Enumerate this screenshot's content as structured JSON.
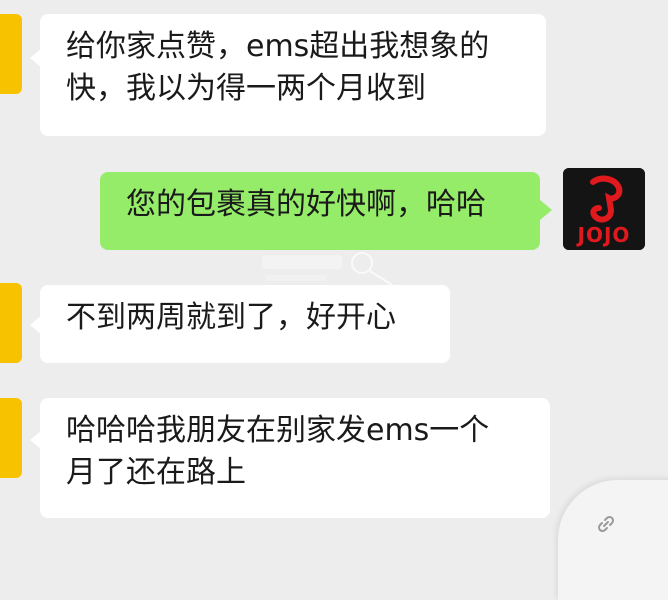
{
  "chat": {
    "messages": [
      {
        "side": "left",
        "text": "给你家点赞，ems超出我想象的\n快，我以为得一两个月收到"
      },
      {
        "side": "right",
        "text": "您的包裹真的好快啊，哈哈"
      },
      {
        "side": "left",
        "text": "不到两周就到了，好开心"
      },
      {
        "side": "left",
        "text": "哈哈哈我朋友在别家发ems一个\n月了还在路上"
      }
    ],
    "right_avatar_text": "JOJO"
  },
  "colors": {
    "background": "#ededed",
    "incoming_bubble": "#ffffff",
    "outgoing_bubble": "#95ec69",
    "left_avatar": "#f7c200",
    "right_avatar_bg": "#141414",
    "right_avatar_red": "#e0191f"
  },
  "icons": {
    "corner_widget": "link-icon",
    "watermark": "watermark-logo"
  }
}
